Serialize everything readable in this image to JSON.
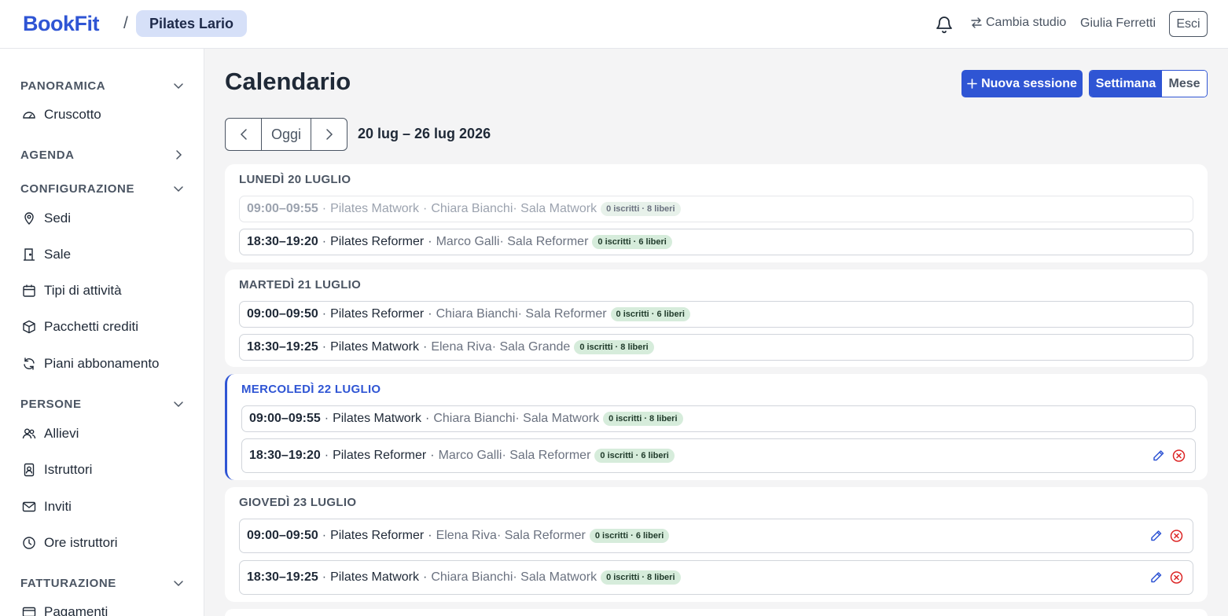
{
  "brand": {
    "logo": "BookFit",
    "separator": "/",
    "studio": "Pilates Lario"
  },
  "header": {
    "switch_studio": "Cambia studio",
    "user_name": "Giulia Ferretti",
    "logout": "Esci"
  },
  "sidebar": {
    "sections": [
      {
        "label": "PANORAMICA",
        "state": "expanded",
        "items": [
          {
            "label": "Cruscotto",
            "icon": "gauge-icon"
          }
        ]
      },
      {
        "label": "AGENDA",
        "state": "collapsed",
        "items": []
      },
      {
        "label": "CONFIGURAZIONE",
        "state": "expanded",
        "items": [
          {
            "label": "Sedi",
            "icon": "map-pin-icon"
          },
          {
            "label": "Sale",
            "icon": "door-icon"
          },
          {
            "label": "Tipi di attività",
            "icon": "calendar-icon"
          },
          {
            "label": "Pacchetti crediti",
            "icon": "package-icon"
          },
          {
            "label": "Piani abbonamento",
            "icon": "refresh-icon"
          }
        ]
      },
      {
        "label": "PERSONE",
        "state": "expanded",
        "items": [
          {
            "label": "Allievi",
            "icon": "users-icon"
          },
          {
            "label": "Istruttori",
            "icon": "badge-icon"
          },
          {
            "label": "Inviti",
            "icon": "mail-icon"
          },
          {
            "label": "Ore istruttori",
            "icon": "clock-icon"
          }
        ]
      },
      {
        "label": "FATTURAZIONE",
        "state": "expanded",
        "items": [
          {
            "label": "Pagamenti",
            "icon": "card-icon"
          }
        ]
      }
    ]
  },
  "main": {
    "title": "Calendario",
    "new_session": "Nuova sessione",
    "view_week": "Settimana",
    "view_month": "Mese",
    "today": "Oggi",
    "date_range": "20 lug – 26 lug 2026"
  },
  "days": [
    {
      "label": "LUNEDÌ 20 LUGLIO",
      "today": false,
      "sessions": [
        {
          "time": "09:00–09:55",
          "activity": "Pilates Matwork",
          "meta": "Chiara Bianchi· Sala Matwork",
          "badge": "0 iscritti · 8 liberi",
          "past": true,
          "actions": false
        },
        {
          "time": "18:30–19:20",
          "activity": "Pilates Reformer",
          "meta": "Marco Galli· Sala Reformer",
          "badge": "0 iscritti · 6 liberi",
          "past": false,
          "actions": false
        }
      ]
    },
    {
      "label": "MARTEDÌ 21 LUGLIO",
      "today": false,
      "sessions": [
        {
          "time": "09:00–09:50",
          "activity": "Pilates Reformer",
          "meta": "Chiara Bianchi· Sala Reformer",
          "badge": "0 iscritti · 6 liberi",
          "past": false,
          "actions": false
        },
        {
          "time": "18:30–19:25",
          "activity": "Pilates Matwork",
          "meta": "Elena Riva· Sala Grande",
          "badge": "0 iscritti · 8 liberi",
          "past": false,
          "actions": false
        }
      ]
    },
    {
      "label": "MERCOLEDÌ 22 LUGLIO",
      "today": true,
      "sessions": [
        {
          "time": "09:00–09:55",
          "activity": "Pilates Matwork",
          "meta": "Chiara Bianchi· Sala Matwork",
          "badge": "0 iscritti · 8 liberi",
          "past": false,
          "actions": false
        },
        {
          "time": "18:30–19:20",
          "activity": "Pilates Reformer",
          "meta": "Marco Galli· Sala Reformer",
          "badge": "0 iscritti · 6 liberi",
          "past": false,
          "actions": true
        }
      ]
    },
    {
      "label": "GIOVEDÌ 23 LUGLIO",
      "today": false,
      "sessions": [
        {
          "time": "09:00–09:50",
          "activity": "Pilates Reformer",
          "meta": "Elena Riva· Sala Reformer",
          "badge": "0 iscritti · 6 liberi",
          "past": false,
          "actions": true
        },
        {
          "time": "18:30–19:25",
          "activity": "Pilates Matwork",
          "meta": "Chiara Bianchi· Sala Matwork",
          "badge": "0 iscritti · 8 liberi",
          "past": false,
          "actions": true
        }
      ]
    }
  ],
  "colors": {
    "accent": "#2f55d4",
    "badge_bg": "#d6ecdb",
    "danger": "#dc2626"
  }
}
